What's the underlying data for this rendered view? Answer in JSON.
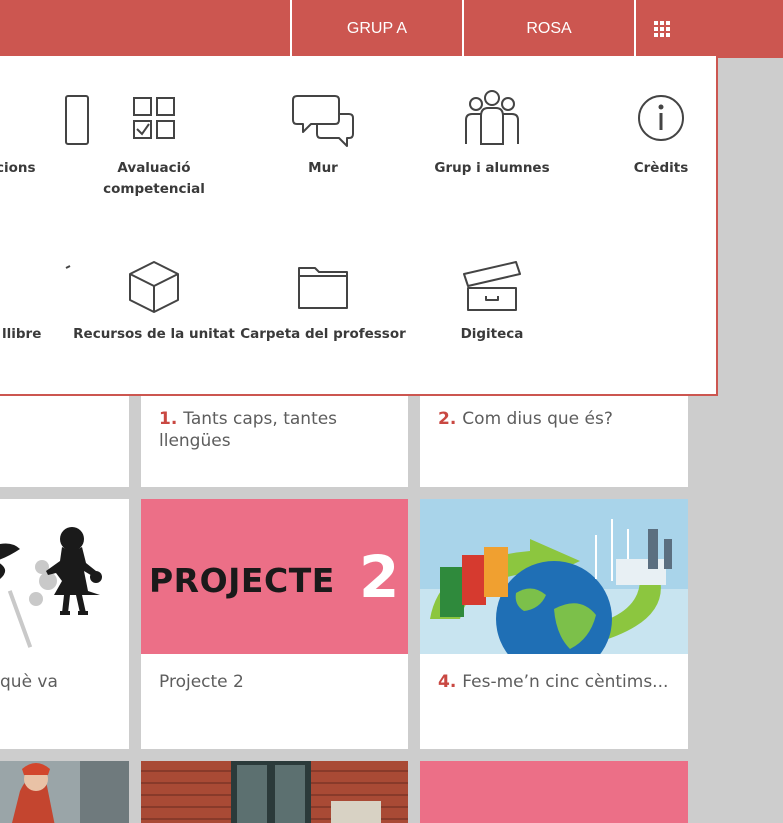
{
  "header": {
    "group_label": "GRUP A",
    "user_label": "ROSA",
    "apps_icon": "apps-grid-icon"
  },
  "colors": {
    "brand": "#cc5650",
    "accent_number": "#c94842",
    "project_pink": "#ec6f87",
    "background": "#cdcdcd"
  },
  "apps_menu": {
    "items": [
      {
        "label": "cions",
        "icon": "document-icon"
      },
      {
        "label": "Avaluació competencial",
        "icon": "checklist-grid-icon"
      },
      {
        "label": "Mur",
        "icon": "speech-bubbles-icon"
      },
      {
        "label": "Grup i alumnes",
        "icon": "group-people-icon"
      },
      {
        "label": "Crèdits",
        "icon": "info-icon"
      },
      {
        "label": "llibre",
        "icon": "book-icon"
      },
      {
        "label": "Recursos de la unitat",
        "icon": "cube-icon"
      },
      {
        "label": "Carpeta del professor",
        "icon": "folder-icon"
      },
      {
        "label": "Digiteca",
        "icon": "archive-box-icon"
      }
    ]
  },
  "units": {
    "row1": [
      {
        "number": "1.",
        "title": "Tants caps, tantes llengües"
      },
      {
        "number": "2.",
        "title": "Com dius que és?"
      }
    ],
    "row2": [
      {
        "number": "",
        "title": "què va"
      },
      {
        "number": "",
        "title": "Projecte 2",
        "cover_text": "PROJECTE",
        "cover_number": "2"
      },
      {
        "number": "4.",
        "title": "Fes-me’n cinc cèntims..."
      }
    ]
  }
}
